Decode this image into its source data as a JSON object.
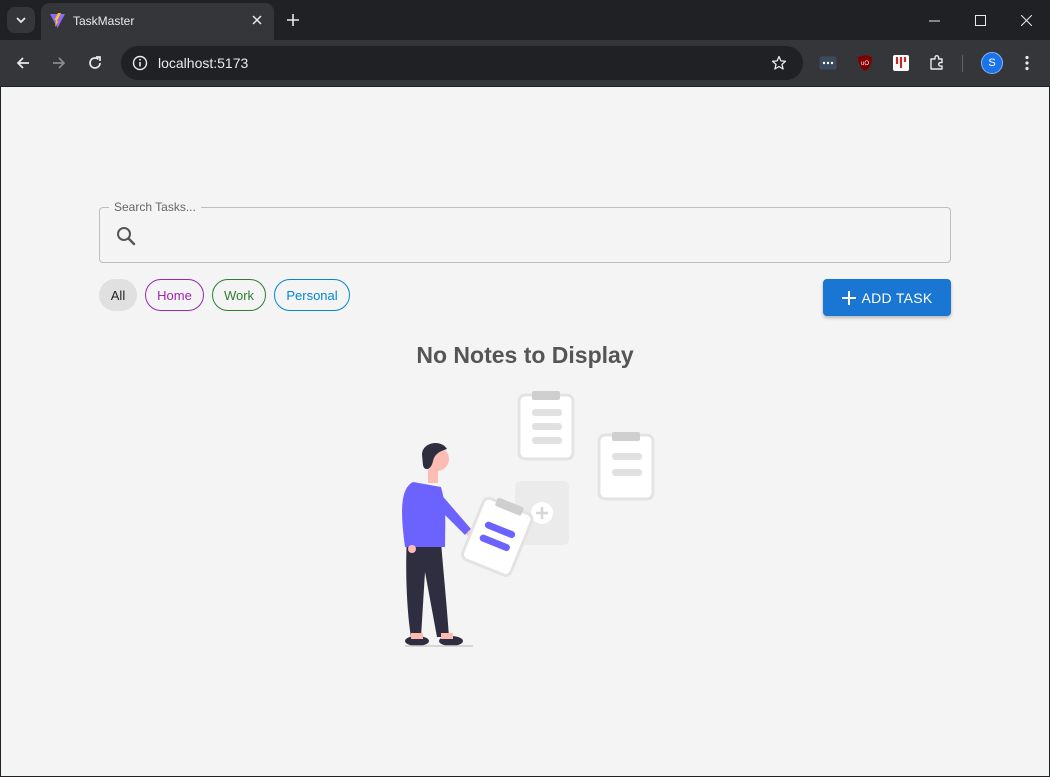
{
  "browser": {
    "tab_title": "TaskMaster",
    "url": "localhost:5173",
    "profile_initial": "S"
  },
  "search": {
    "label": "Search Tasks...",
    "value": ""
  },
  "filters": [
    {
      "label": "All",
      "selected": true
    },
    {
      "label": "Home",
      "color": "#9c27b0"
    },
    {
      "label": "Work",
      "color": "#2e7d32"
    },
    {
      "label": "Personal",
      "color": "#0288d1"
    }
  ],
  "add_button": {
    "label": "ADD TASK",
    "color": "#1976d2"
  },
  "empty_state": {
    "title": "No Notes to Display",
    "accent_color": "#6c63ff"
  }
}
